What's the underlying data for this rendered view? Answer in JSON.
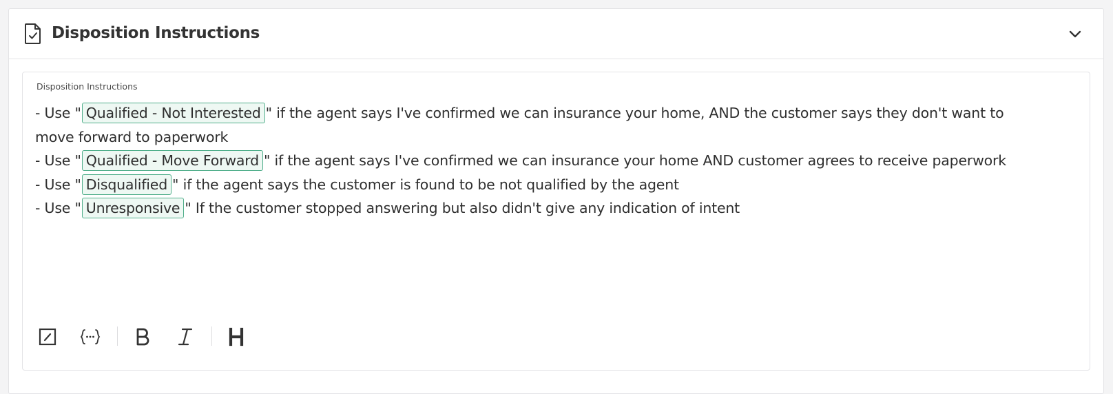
{
  "section": {
    "title": "Disposition Instructions",
    "icon": "document-check-icon",
    "collapse_icon": "chevron-down-icon"
  },
  "editor": {
    "label": "Disposition Instructions",
    "lines": [
      {
        "prefix": "- Use \"",
        "chip": "Qualified - Not Interested",
        "suffix": "\" if the agent says I've confirmed we can insurance your home, AND the customer says they don't want to move forward to paperwork"
      },
      {
        "prefix": "- Use \"",
        "chip": "Qualified - Move Forward",
        "suffix": "\" if the agent says I've confirmed we can insurance your home AND customer agrees to receive paperwork"
      },
      {
        "prefix": "- Use \"",
        "chip": "Disqualified",
        "suffix": "\" if the agent says the customer is found to be not qualified by the agent"
      },
      {
        "prefix": "- Use \"",
        "chip": "Unresponsive",
        "suffix": "\" If the customer stopped answering but also didn't give any indication of intent"
      }
    ],
    "toolbar": [
      {
        "name": "edit-box-icon"
      },
      {
        "name": "variable-braces-icon"
      },
      {
        "name": "bold-icon"
      },
      {
        "name": "italic-icon"
      },
      {
        "name": "heading-icon"
      }
    ]
  },
  "colors": {
    "chip_border": "#4fae8a",
    "chip_background": "#eef8f3",
    "border": "#e3e3e6"
  }
}
